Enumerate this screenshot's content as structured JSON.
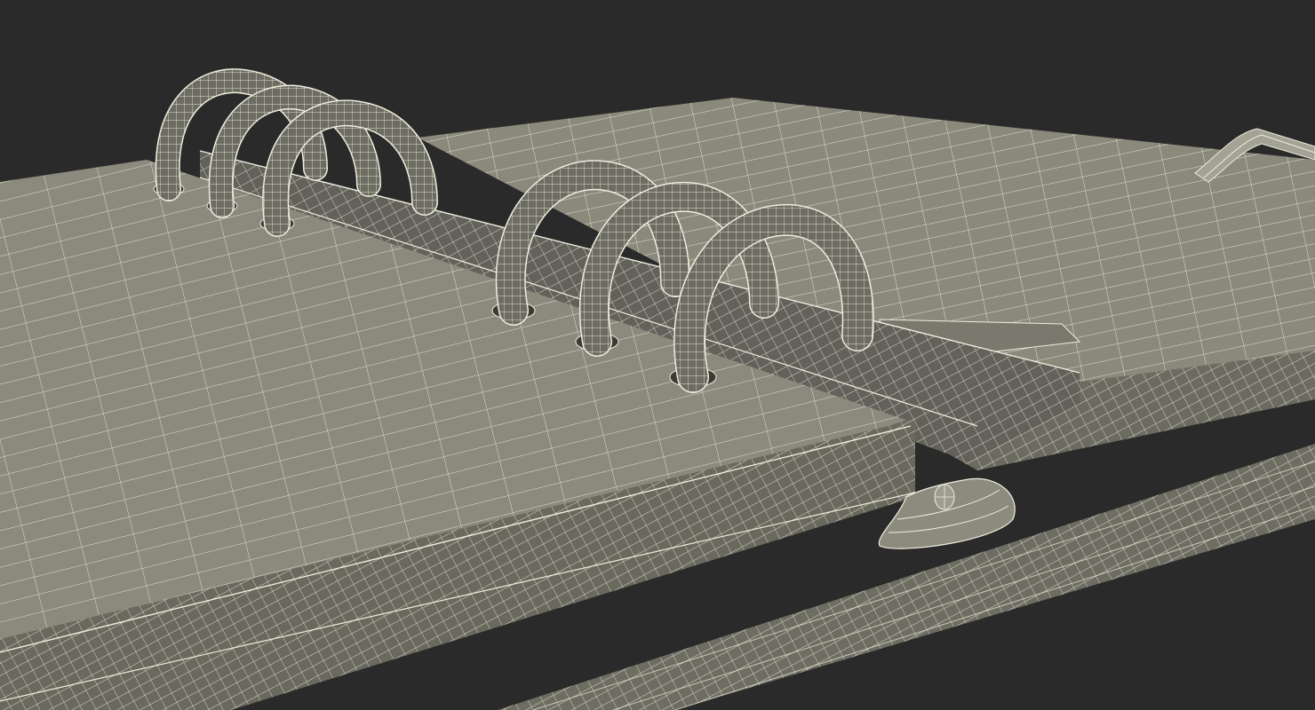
{
  "scene": {
    "subject": "ring-binder-organizer-wireframe",
    "ring_count": 6,
    "colors": {
      "background": "#2a2a2a",
      "surface": "#7f7e71",
      "surface_light": "#8b8a7d",
      "surface_dark": "#5f5e54",
      "wire": "#eeeede",
      "ring_fill": "#6d6c62"
    }
  }
}
